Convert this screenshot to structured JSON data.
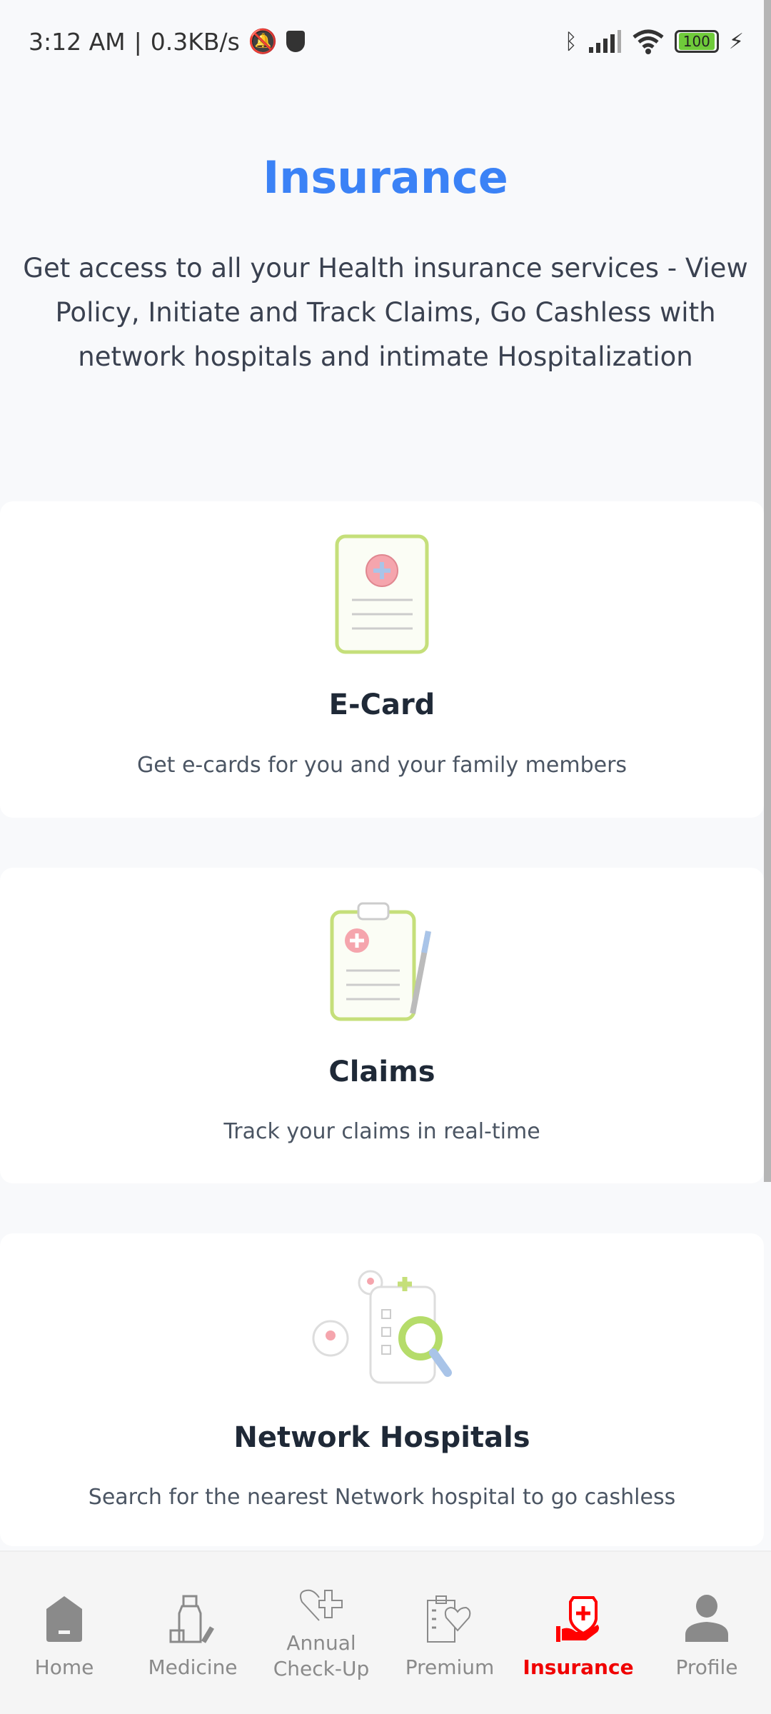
{
  "status_bar": {
    "time": "3:12 AM",
    "speed": "0.3KB/s",
    "battery": "100"
  },
  "header": {
    "title": "Insurance",
    "description": "Get access to all your Health insurance services - View Policy, Initiate and Track Claims, Go Cashless with network hospitals and intimate Hospitalization"
  },
  "cards": [
    {
      "title": "E-Card",
      "subtitle": "Get e-cards for you and your family members",
      "icon": "ecard-icon"
    },
    {
      "title": "Claims",
      "subtitle": "Track your claims in real-time",
      "icon": "clipboard-icon"
    },
    {
      "title": "Network Hospitals",
      "subtitle": "Search for the nearest Network hospital to go cashless",
      "icon": "hospital-search-icon"
    }
  ],
  "nav": {
    "items": [
      {
        "label": "Home",
        "icon": "home-icon"
      },
      {
        "label": "Medicine",
        "icon": "medicine-icon"
      },
      {
        "label": "Annual Check-Up",
        "icon": "heart-plus-icon"
      },
      {
        "label": "Premium",
        "icon": "clipboard-heart-icon"
      },
      {
        "label": "Insurance",
        "icon": "shield-hand-icon",
        "active": true
      },
      {
        "label": "Profile",
        "icon": "person-icon"
      }
    ]
  },
  "colors": {
    "accent": "#3b82f6",
    "nav_active": "#f00000",
    "nav_inactive": "#8a8a8a"
  }
}
